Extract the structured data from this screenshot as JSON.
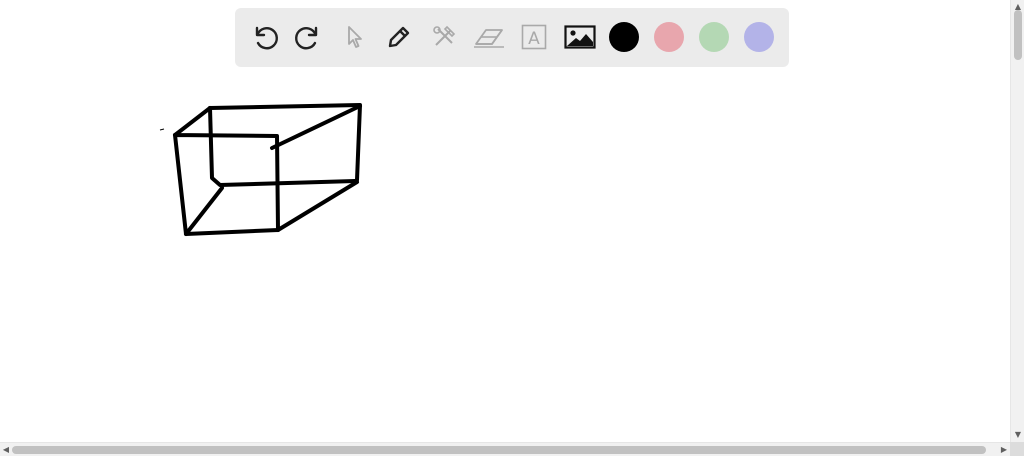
{
  "toolbar": {
    "tools": [
      {
        "name": "undo-icon",
        "enabled": true
      },
      {
        "name": "redo-icon",
        "enabled": true
      },
      {
        "name": "pointer-icon",
        "enabled": false
      },
      {
        "name": "pencil-icon",
        "enabled": true
      },
      {
        "name": "tools-icon",
        "enabled": false
      },
      {
        "name": "eraser-icon",
        "enabled": false
      },
      {
        "name": "text-icon",
        "enabled": false
      },
      {
        "name": "image-icon",
        "enabled": true
      }
    ],
    "text_tool_glyph": "A",
    "colors": [
      {
        "name": "color-black",
        "hex": "#000000"
      },
      {
        "name": "color-pink",
        "hex": "#e8a6ad"
      },
      {
        "name": "color-green",
        "hex": "#b4d8b4"
      },
      {
        "name": "color-lavender",
        "hex": "#b3b3e8"
      }
    ],
    "icon_color": "#222222",
    "disabled_icon_color": "#a9a9a9"
  },
  "scrollbars": {
    "up_arrow": "▲",
    "down_arrow": "▼",
    "left_arrow": "◀",
    "right_arrow": "▶"
  }
}
